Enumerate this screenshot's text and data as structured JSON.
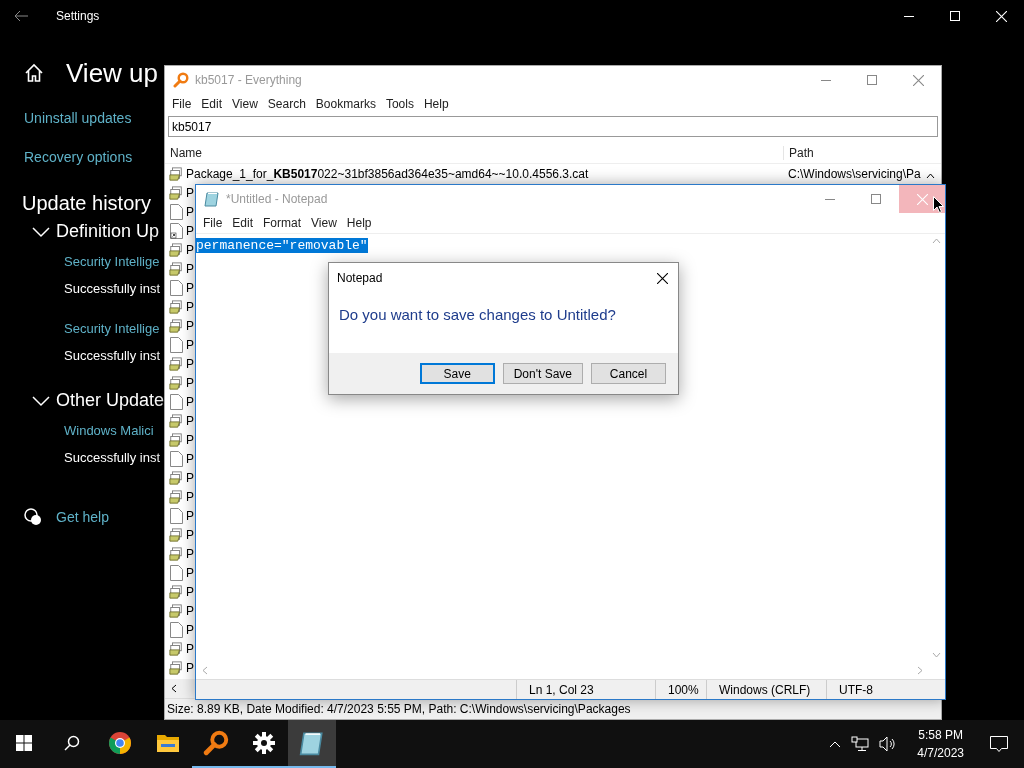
{
  "settings": {
    "title": "Settings",
    "heading": "View up",
    "links": [
      "Uninstall updates",
      "Recovery options"
    ],
    "section_title": "Update history",
    "groups": [
      {
        "title": "Definition Up",
        "expanded": true,
        "items": [
          {
            "name": "Security Intellige",
            "status": "Successfully inst"
          },
          {
            "name": "Security Intellige",
            "status": "Successfully inst"
          }
        ]
      },
      {
        "title": "Other Update",
        "expanded": true,
        "items": [
          {
            "name": "Windows Malici",
            "status": "Successfully inst"
          }
        ]
      }
    ],
    "help_link": "Get help"
  },
  "everything": {
    "title": "kb5017 - Everything",
    "menu": [
      "File",
      "Edit",
      "View",
      "Search",
      "Bookmarks",
      "Tools",
      "Help"
    ],
    "search": {
      "value": "kb5017"
    },
    "columns": [
      "Name",
      "Path"
    ],
    "rows": [
      {
        "kind": "package",
        "name": "Package_1_for_**KB5017**022~31bf3856ad364e35~amd64~~10.0.4556.3.cat",
        "path": "C:\\Windows\\servicing\\Pa"
      },
      {
        "kind": "package",
        "name": "P"
      },
      {
        "kind": "file",
        "name": "P"
      },
      {
        "kind": "shortcut",
        "name": "P"
      },
      {
        "kind": "package",
        "name": "P"
      },
      {
        "kind": "package",
        "name": "P"
      },
      {
        "kind": "file",
        "name": "P"
      },
      {
        "kind": "package",
        "name": "P"
      },
      {
        "kind": "package",
        "name": "P"
      },
      {
        "kind": "file",
        "name": "P"
      },
      {
        "kind": "package",
        "name": "P"
      },
      {
        "kind": "package",
        "name": "P"
      },
      {
        "kind": "file",
        "name": "P"
      },
      {
        "kind": "package",
        "name": "P"
      },
      {
        "kind": "package",
        "name": "P"
      },
      {
        "kind": "file",
        "name": "P"
      },
      {
        "kind": "package",
        "name": "P"
      },
      {
        "kind": "package",
        "name": "P"
      },
      {
        "kind": "file",
        "name": "P"
      },
      {
        "kind": "package",
        "name": "P"
      },
      {
        "kind": "package",
        "name": "P"
      },
      {
        "kind": "file",
        "name": "P"
      },
      {
        "kind": "package",
        "name": "P"
      },
      {
        "kind": "package",
        "name": "P"
      },
      {
        "kind": "file",
        "name": "P"
      },
      {
        "kind": "package",
        "name": "P"
      },
      {
        "kind": "package",
        "name": "P"
      }
    ],
    "status_bar": "Size: 8.89 KB, Date Modified: 4/7/2023 5:55 PM, Path: C:\\Windows\\servicing\\Packages"
  },
  "notepad": {
    "title": "*Untitled - Notepad",
    "menu": [
      "File",
      "Edit",
      "Format",
      "View",
      "Help"
    ],
    "text": "permanence=\"removable\"",
    "text_selected": true,
    "close_hovered": true,
    "status": [
      "Ln 1, Col 23",
      "100%",
      "Windows (CRLF)",
      "UTF-8"
    ]
  },
  "dialog": {
    "title": "Notepad",
    "message": "Do you want to save changes to Untitled?",
    "buttons": [
      {
        "label": "Save",
        "default": true
      },
      {
        "label": "Don't Save",
        "default": false
      },
      {
        "label": "Cancel",
        "default": false
      }
    ]
  },
  "taskbar": {
    "apps": [
      {
        "kind": "chrome",
        "running": false,
        "selected": false
      },
      {
        "kind": "explorer",
        "running": false,
        "selected": false
      },
      {
        "kind": "everything",
        "running": true,
        "selected": false
      },
      {
        "kind": "settings",
        "running": true,
        "selected": false
      },
      {
        "kind": "notepad",
        "running": true,
        "selected": true
      }
    ],
    "time": "5:58 PM",
    "date": "4/7/2023"
  }
}
